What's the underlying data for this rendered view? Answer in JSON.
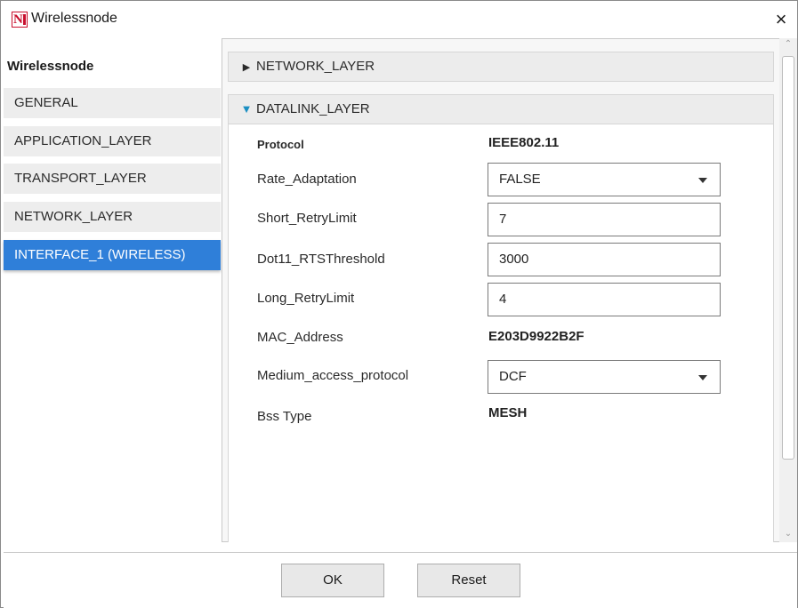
{
  "window": {
    "title": "Wirelessnode",
    "logo_icon": "netsim-n-logo",
    "close_glyph": "×"
  },
  "sidebar": {
    "title": "Wirelessnode",
    "items": [
      {
        "label": "GENERAL",
        "active": false
      },
      {
        "label": "APPLICATION_LAYER",
        "active": false
      },
      {
        "label": "TRANSPORT_LAYER",
        "active": false
      },
      {
        "label": "NETWORK_LAYER",
        "active": false
      },
      {
        "label": "INTERFACE_1 (WIRELESS)",
        "active": true
      }
    ]
  },
  "sections": {
    "network_layer": {
      "label": "NETWORK_LAYER",
      "expanded": false
    },
    "datalink_layer": {
      "label": "DATALINK_LAYER",
      "expanded": true
    }
  },
  "datalink": {
    "protocol": {
      "label": "Protocol",
      "value": "IEEE802.11"
    },
    "rate_adaptation": {
      "label": "Rate_Adaptation",
      "value": "FALSE"
    },
    "short_retry_limit": {
      "label": "Short_RetryLimit",
      "value": "7"
    },
    "rts_threshold": {
      "label": "Dot11_RTSThreshold",
      "value": "3000"
    },
    "long_retry_limit": {
      "label": "Long_RetryLimit",
      "value": "4"
    },
    "mac_address": {
      "label": "MAC_Address",
      "value": "E203D9922B2F"
    },
    "medium_access_protocol": {
      "label": "Medium_access_protocol",
      "value": "DCF"
    },
    "bss_type": {
      "label": "Bss Type",
      "value": "MESH"
    }
  },
  "footer": {
    "ok_label": "OK",
    "reset_label": "Reset"
  },
  "colors": {
    "accent": "#2f7fd9",
    "expand_arrow": "#1b8fc2",
    "logo_red": "#c8102e"
  }
}
